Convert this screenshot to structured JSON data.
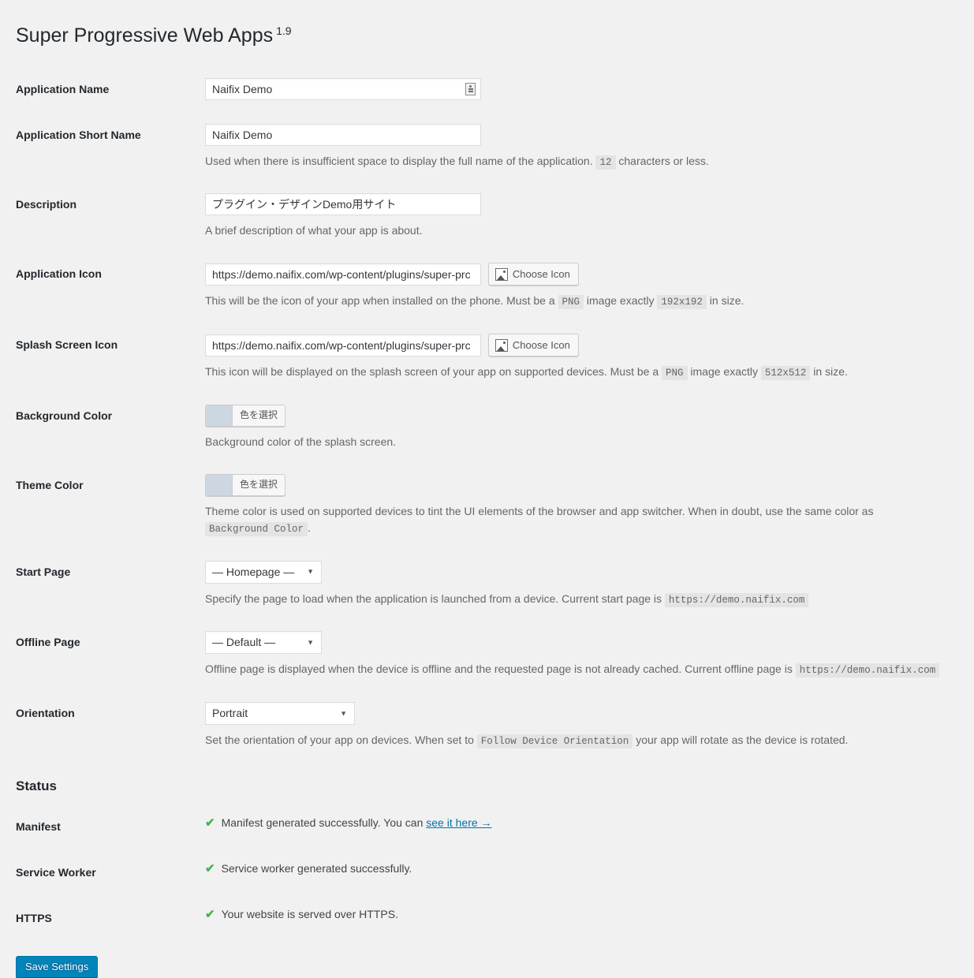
{
  "header": {
    "title": "Super Progressive Web Apps",
    "version": "1.9"
  },
  "fields": {
    "app_name": {
      "label": "Application Name",
      "value": "Naifix Demo",
      "placeholder": "",
      "autofill_icon": "autofill-icon"
    },
    "app_short_name": {
      "label": "Application Short Name",
      "value": "Naifix Demo",
      "placeholder": "",
      "desc_before": "Used when there is insufficient space to display the full name of the application.",
      "desc_code": "12",
      "desc_after": "characters or less."
    },
    "description": {
      "label": "Description",
      "value": "プラグイン・デザインDemo用サイト",
      "placeholder": "",
      "desc": "A brief description of what your app is about."
    },
    "app_icon": {
      "label": "Application Icon",
      "value": "https://demo.naifix.com/wp-content/plugins/super-prc",
      "button_label": "Choose Icon",
      "button_icon": "media-image-icon",
      "desc_part1": "This will be the icon of your app when installed on the phone. Must be a",
      "desc_code1": "PNG",
      "desc_part2": "image exactly",
      "desc_code2": "192x192",
      "desc_part3": "in size."
    },
    "splash_icon": {
      "label": "Splash Screen Icon",
      "value": "https://demo.naifix.com/wp-content/plugins/super-prc",
      "button_label": "Choose Icon",
      "button_icon": "media-image-icon",
      "desc_part1": "This icon will be displayed on the splash screen of your app on supported devices. Must be a",
      "desc_code1": "PNG",
      "desc_part2": "image exactly",
      "desc_code2": "512x512",
      "desc_part3": "in size."
    },
    "background_color": {
      "label": "Background Color",
      "button_label": "色を選択",
      "swatch_color": "#ccd7e2",
      "desc": "Background color of the splash screen."
    },
    "theme_color": {
      "label": "Theme Color",
      "button_label": "色を選択",
      "swatch_color": "#ccd7e2",
      "desc_part1": "Theme color is used on supported devices to tint the UI elements of the browser and app switcher. When in doubt, use the same color as",
      "desc_code": "Background Color",
      "desc_part2": "."
    },
    "start_page": {
      "label": "Start Page",
      "selected": "— Homepage —",
      "options": [
        "— Homepage —"
      ],
      "desc_part1": "Specify the page to load when the application is launched from a device. Current start page is",
      "desc_code": "https://demo.naifix.com"
    },
    "offline_page": {
      "label": "Offline Page",
      "selected": "— Default —",
      "options": [
        "— Default —"
      ],
      "desc_part1": "Offline page is displayed when the device is offline and the requested page is not already cached. Current offline page is",
      "desc_code": "https://demo.naifix.com"
    },
    "orientation": {
      "label": "Orientation",
      "selected": "Portrait",
      "options": [
        "Portrait"
      ],
      "desc_part1": "Set the orientation of your app on devices. When set to",
      "desc_code": "Follow Device Orientation",
      "desc_part2": "your app will rotate as the device is rotated."
    }
  },
  "status": {
    "heading": "Status",
    "items": [
      {
        "label": "Manifest",
        "icon": "check-icon",
        "text": "Manifest generated successfully. You can",
        "link_text": "see it here →"
      },
      {
        "label": "Service Worker",
        "icon": "check-icon",
        "text": "Service worker generated successfully.",
        "link_text": ""
      },
      {
        "label": "HTTPS",
        "icon": "check-icon",
        "text": "Your website is served over HTTPS.",
        "link_text": ""
      }
    ]
  },
  "submit": {
    "save_label": "Save Settings"
  },
  "colors": {
    "accent": "#0085ba",
    "link": "#0073aa",
    "success": "#46b450",
    "page_bg": "#f1f1f1"
  }
}
